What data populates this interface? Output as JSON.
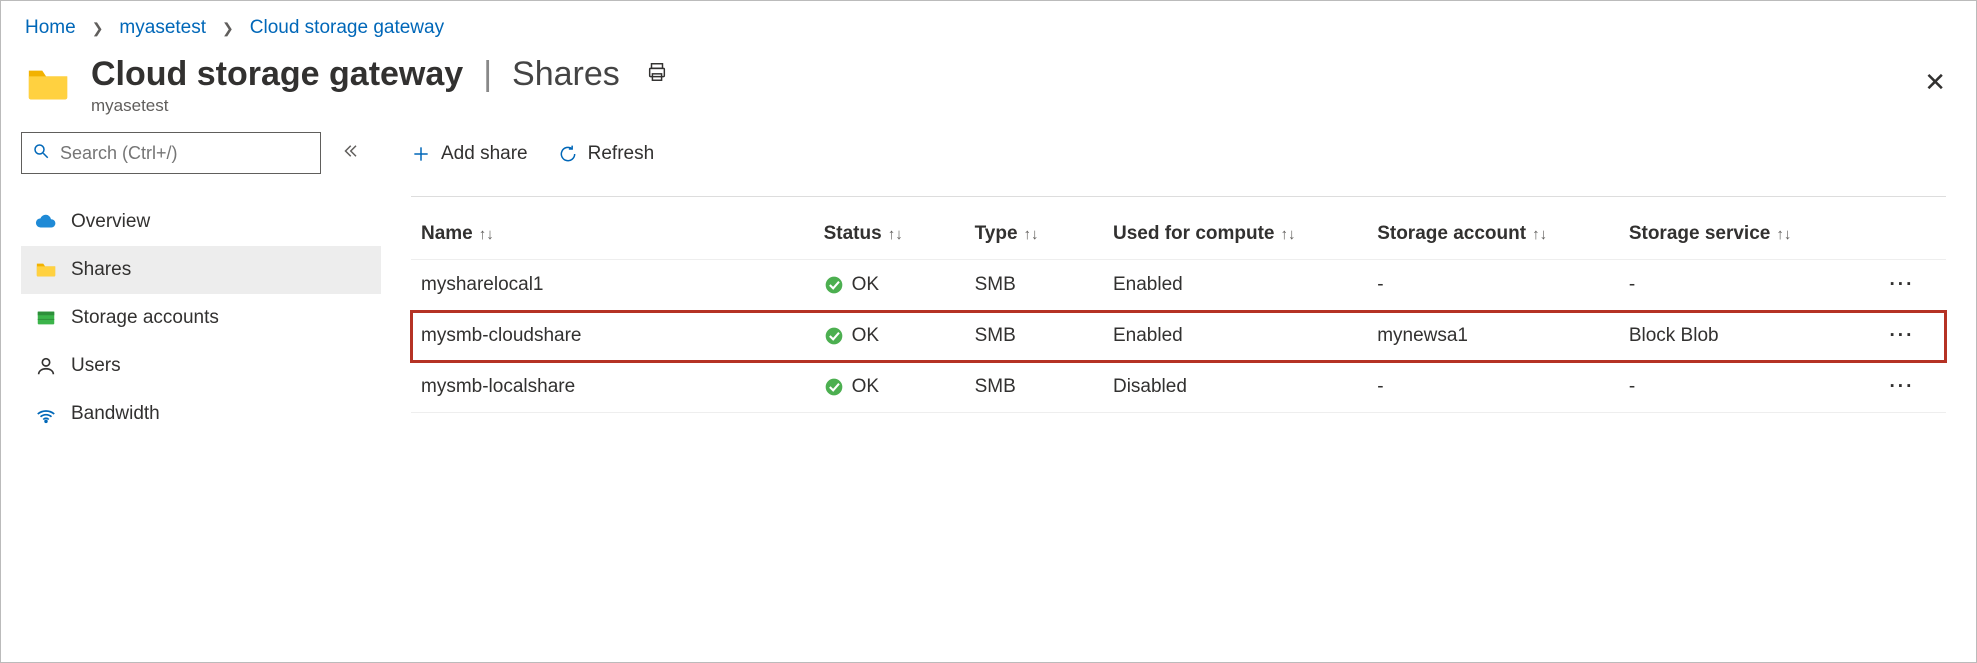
{
  "breadcrumb": {
    "home": "Home",
    "resource": "myasetest",
    "section": "Cloud storage gateway"
  },
  "header": {
    "title": "Cloud storage gateway",
    "page": "Shares",
    "subtitle": "myasetest"
  },
  "search": {
    "placeholder": "Search (Ctrl+/)"
  },
  "sidebar": {
    "items": [
      {
        "label": "Overview",
        "icon": "cloud"
      },
      {
        "label": "Shares",
        "icon": "folder",
        "active": true
      },
      {
        "label": "Storage accounts",
        "icon": "storage"
      },
      {
        "label": "Users",
        "icon": "user"
      },
      {
        "label": "Bandwidth",
        "icon": "bandwidth"
      }
    ]
  },
  "toolbar": {
    "add_label": "Add share",
    "refresh_label": "Refresh"
  },
  "table": {
    "columns": {
      "name": "Name",
      "status": "Status",
      "type": "Type",
      "compute": "Used for compute",
      "account": "Storage account",
      "service": "Storage service"
    },
    "rows": [
      {
        "name": "mysharelocal1",
        "status": "OK",
        "type": "SMB",
        "compute": "Enabled",
        "account": "-",
        "service": "-",
        "highlight": false
      },
      {
        "name": "mysmb-cloudshare",
        "status": "OK",
        "type": "SMB",
        "compute": "Enabled",
        "account": "mynewsa1",
        "service": "Block Blob",
        "highlight": true
      },
      {
        "name": "mysmb-localshare",
        "status": "OK",
        "type": "SMB",
        "compute": "Disabled",
        "account": "-",
        "service": "-",
        "highlight": false
      }
    ]
  }
}
